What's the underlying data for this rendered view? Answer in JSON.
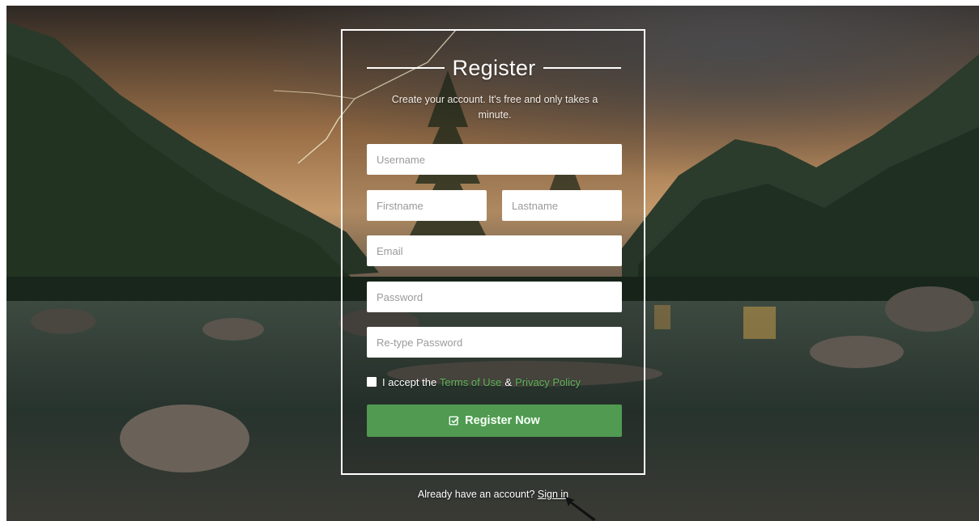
{
  "card": {
    "title": "Register",
    "subtitle": "Create your account. It's free and only takes a minute."
  },
  "form": {
    "username_placeholder": "Username",
    "firstname_placeholder": "Firstname",
    "lastname_placeholder": "Lastname",
    "email_placeholder": "Email",
    "password_placeholder": "Password",
    "retype_password_placeholder": "Re-type Password",
    "terms_prefix": "I accept the",
    "terms_link": "Terms of Use",
    "terms_and": "&",
    "privacy_link": "Privacy Policy",
    "submit_label": "Register Now",
    "submit_icon": "check-square-icon"
  },
  "footer": {
    "prompt": "Already have an account?",
    "signin_link": "Sign in"
  },
  "colors": {
    "accent": "#5cb85c",
    "card_border": "#ffffff"
  }
}
